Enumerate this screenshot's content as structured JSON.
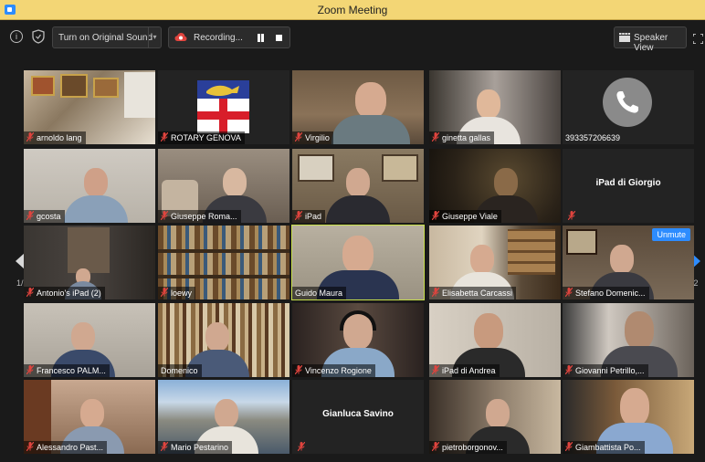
{
  "window": {
    "title": "Zoom Meeting"
  },
  "toolbar": {
    "info_icon": "info-icon",
    "security_icon": "shield-icon",
    "original_sound_label": "Turn on Original Sound",
    "recording_label": "Recording...",
    "view_label": "Speaker View"
  },
  "pagination": {
    "left": "1/2",
    "right": "1/2"
  },
  "tiles": [
    {
      "name": "arnoldo lang",
      "muted": true
    },
    {
      "name": "ROTARY GENOVA",
      "muted": true
    },
    {
      "name": "Virgilio",
      "muted": true
    },
    {
      "name": "ginetta gallas",
      "muted": true
    },
    {
      "name": "393357206639",
      "muted": false
    },
    {
      "name": "gcosta",
      "muted": true
    },
    {
      "name": "Giuseppe Roma...",
      "muted": true
    },
    {
      "name": "iPad",
      "muted": true
    },
    {
      "name": "Giuseppe Viale",
      "muted": true
    },
    {
      "name": "iPad di Giorgio",
      "muted": true
    },
    {
      "name": "Antonio's iPad (2)",
      "muted": true
    },
    {
      "name": "loewy",
      "muted": true
    },
    {
      "name": "Guido Maura",
      "muted": false
    },
    {
      "name": "Elisabetta Carcassi",
      "muted": true
    },
    {
      "name": "Stefano Domenic...",
      "muted": true
    },
    {
      "name": "Francesco PALM...",
      "muted": true
    },
    {
      "name": "Domenico",
      "muted": false
    },
    {
      "name": "Vincenzo Rogione",
      "muted": true
    },
    {
      "name": "iPad di Andrea",
      "muted": true
    },
    {
      "name": "Giovanni Petrillo,...",
      "muted": true
    },
    {
      "name": "Alessandro Past...",
      "muted": true
    },
    {
      "name": "Mario Pestarino",
      "muted": true
    },
    {
      "name": "Gianluca Savino",
      "muted": true
    },
    {
      "name": "pietroborgonov...",
      "muted": true
    },
    {
      "name": "Giambattista Po...",
      "muted": true
    }
  ],
  "unmute_label": "Unmute",
  "colors": {
    "titlebar": "#f3d675",
    "active_speaker_border": "#c8e04a",
    "accent": "#2d8cff",
    "muted_icon": "#e0443e"
  }
}
